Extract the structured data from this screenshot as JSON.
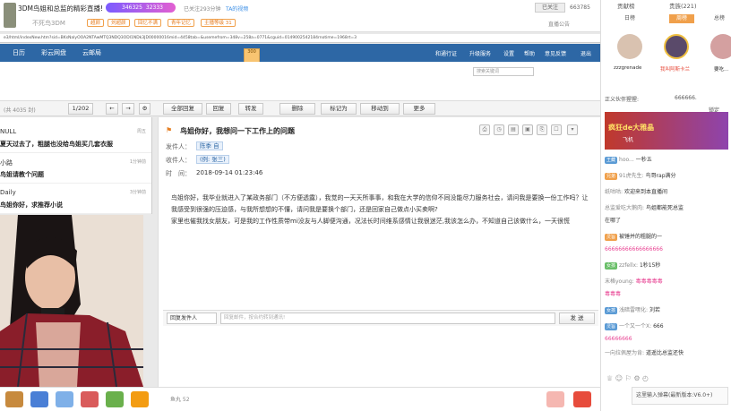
{
  "stream": {
    "title": "3DM鸟姐和总监的精彩直播!",
    "popularity": [
      "346325",
      "32333"
    ],
    "follow_count": "已关注293分钟",
    "share": "TA的视频",
    "follow_state": "已关注",
    "viewers": "663785",
    "streamer_name": "不死鸟3DM",
    "tags": [
      "超颜",
      "刘超颜",
      "回忆不满",
      "青年记忆",
      "主播等级 31"
    ],
    "report": "直播公告"
  },
  "url": "e3/html/indexNew.htm?sid=BKsNalyOOA2NTAwMTQ3NDQ3ODI1NDk3JD00000016mid=4458tab=&usemefrom=348v=258a=0771&cguid=0149002542184rnotime=1968rt=3",
  "mail_nav": {
    "left": [
      "日历",
      "彩云网盘",
      "云邮局"
    ],
    "right": [
      "和通行证",
      "升级服务",
      "设置",
      "帮助",
      "意见反馈",
      "退出"
    ],
    "badge": "300"
  },
  "search_placeholder": "搜索关键词",
  "toolbar": {
    "folder_count": "(共 4035 封)",
    "page": "1/202",
    "buttons": [
      "全部回复",
      "回复",
      "转发",
      "删除",
      "标记为",
      "移动到",
      "更多"
    ]
  },
  "mail_list": [
    {
      "sender": "NULL",
      "subject": "夏天过去了，粗腿也没给鸟姐买几套衣服",
      "time": "周五"
    },
    {
      "sender": "小路",
      "subject": "鸟姐请教个问题",
      "time": "1分钟前"
    },
    {
      "sender": "Daily",
      "subject": "鸟姐你好，求推荐小说",
      "time": "3分钟前"
    }
  ],
  "mail": {
    "subject": "鸟姐你好，我想问一下工作上的问题",
    "from_label": "发件人：",
    "from": "陈季 自",
    "to_label": "收件人：",
    "to": "(例: 张三)",
    "time_label": "时　间：",
    "time": "2018-09-14 01:23:46",
    "body": "鸟姐你好，我毕业就进入了某政务部门（不方便透露），我觉的一天天所事事，和我在大学的信仰不同没能尽力服务社会，请问我是要换一份工作吗？让我感受到很强的压迫感，与我所想想的不懂，请问我是要换个部门，还是回家自己做点小买卖啊?\n家里也催我找女朋友，可是我的工作性质带mi没友与人脚便沟通，况法长时间维系感情让我很迷茫,我该怎么办，不知道自己该做什么，一天很慌"
  },
  "reply": {
    "select": "回复发件人",
    "placeholder": "回复邮件，按合约转到通讯!",
    "send": "发 送"
  },
  "gift_bar": {
    "fishball": "鱼丸 52"
  },
  "right_panel": {
    "tabs": [
      "贡献榜",
      "贵族(221)"
    ],
    "subtabs": [
      "日榜",
      "周榜",
      "总榜"
    ],
    "ranks": [
      {
        "name": "zzzgrenade"
      },
      {
        "name": "我叫阿斯卡兰"
      },
      {
        "name": "要吃..."
      }
    ],
    "owner_text": "正义伙伴猩猩:",
    "owner_val": "666666.",
    "lock": "锁定",
    "banner_title": "疯狂de大雅晶",
    "banner_sub": "飞机",
    "chat": [
      {
        "badge": "王藏",
        "user": "hoo...",
        "msg": "一秒五",
        "c": "b-blue"
      },
      {
        "badge": "兄弟",
        "user": "91虎先生:",
        "msg": "鸟哥rap满分",
        "c": "b-orange"
      },
      {
        "badge": "",
        "user": "纸咕咕:",
        "msg": "欢迎来到本直播间",
        "c": ""
      },
      {
        "badge": "",
        "user": "总监爱吃大鹅肉:",
        "msg": "鸟姐都能死总监",
        "c": ""
      },
      {
        "badge": "",
        "user": "",
        "msg": "在哪了",
        "c": ""
      },
      {
        "badge": "灵旨",
        "user": "",
        "msg": "被锤并的粗腿的一",
        "c": "b-orange"
      },
      {
        "badge": "",
        "user": "",
        "msg": "66666666666666666",
        "c": "pink"
      },
      {
        "badge": "女孩",
        "user": "zzfellx:",
        "msg": "1秒15秒",
        "c": "b-green"
      },
      {
        "badge": "",
        "user": "末格young:",
        "msg": "毒毒毒毒毒",
        "c": "pink"
      },
      {
        "badge": "",
        "user": "",
        "msg": "毒毒毒",
        "c": "pink"
      },
      {
        "badge": "女孩",
        "user": "浅暗雷嘿化:",
        "msg": "刘若",
        "c": "b-blue"
      },
      {
        "badge": "灵旨",
        "user": "一个又一个X:",
        "msg": "666",
        "c": "b-blue"
      },
      {
        "badge": "",
        "user": "",
        "msg": "66666666",
        "c": "pink"
      },
      {
        "badge": "",
        "user": "一向拉佩屋为肯:",
        "msg": "道遥比总监还快",
        "c": ""
      }
    ],
    "chat_input": "这里输入弹幕(最新版本:V6.0+)"
  }
}
